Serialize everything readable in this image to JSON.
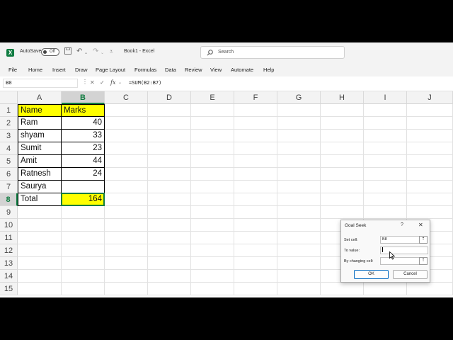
{
  "titlebar": {
    "app_icon": "excel-icon",
    "autosave_label": "AutoSave",
    "autosave_state": "Off",
    "document_title": "Book1 - Excel",
    "search_placeholder": "Search",
    "icons": [
      "save-icon",
      "undo-icon",
      "redo-icon",
      "customize-toolbar-icon"
    ]
  },
  "menu": [
    "File",
    "Home",
    "Insert",
    "Draw",
    "Page Layout",
    "Formulas",
    "Data",
    "Review",
    "View",
    "Automate",
    "Help"
  ],
  "formula_bar": {
    "name_box": "B8",
    "fx_label": "fx",
    "formula": "=SUM(B2:B7)"
  },
  "sheet": {
    "columns": [
      "A",
      "B",
      "C",
      "D",
      "E",
      "F",
      "G",
      "H",
      "I",
      "J"
    ],
    "rows": [
      "1",
      "2",
      "3",
      "4",
      "5",
      "6",
      "7",
      "8",
      "9",
      "10",
      "11",
      "12",
      "13",
      "14",
      "15"
    ],
    "active_cell": "B8",
    "header": {
      "name": "Name",
      "marks": "Marks"
    },
    "data": [
      {
        "name": "Ram",
        "marks": "40"
      },
      {
        "name": "shyam",
        "marks": "33"
      },
      {
        "name": "Sumit",
        "marks": "23"
      },
      {
        "name": "Amit",
        "marks": "44"
      },
      {
        "name": "Ratnesh",
        "marks": "24"
      },
      {
        "name": "Saurya",
        "marks": ""
      }
    ],
    "total": {
      "name": "Total",
      "marks": "164"
    },
    "highlight_color": "#ffff00",
    "accent_color": "#107c41"
  },
  "goal_seek": {
    "title": "Goal Seek",
    "help": "?",
    "close": "✕",
    "set_cell_label": "Set cell:",
    "set_cell_value": "B8",
    "to_value_label": "To value:",
    "to_value_value": "",
    "by_changing_label": "By changing cell:",
    "by_changing_value": "",
    "ok_label": "OK",
    "cancel_label": "Cancel"
  }
}
